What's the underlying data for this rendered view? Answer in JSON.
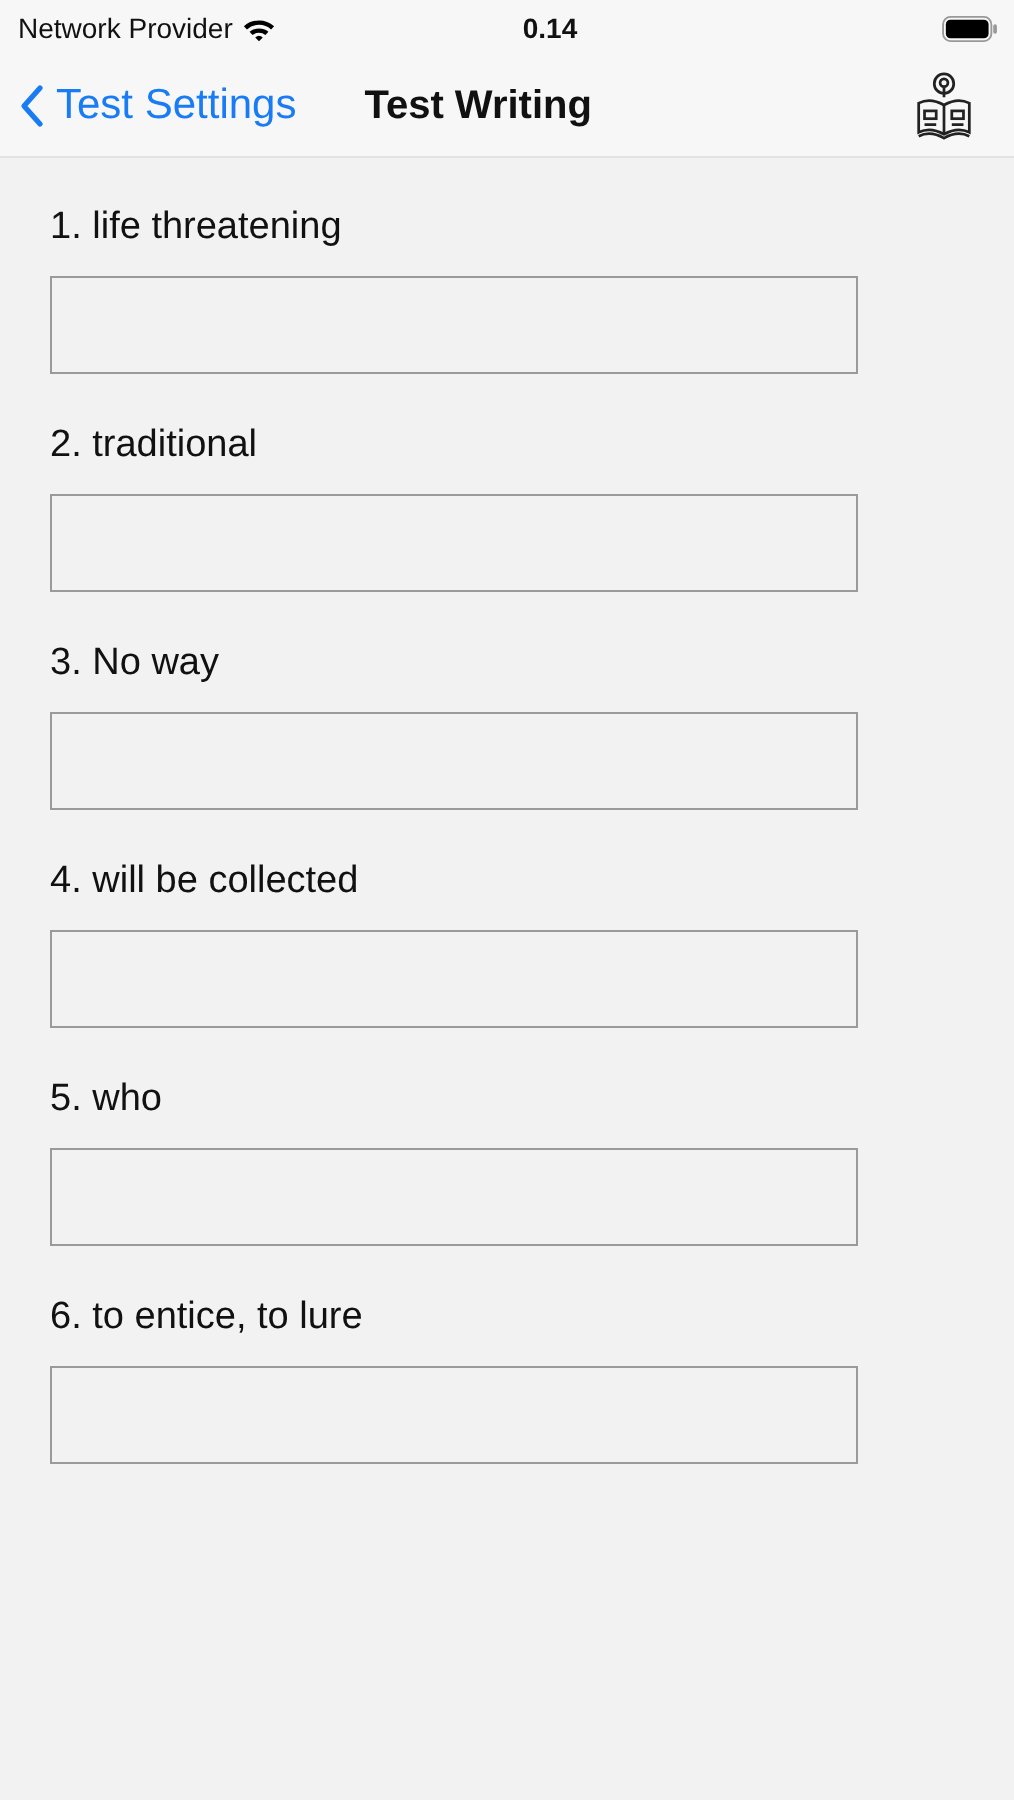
{
  "status_bar": {
    "carrier": "Network Provider",
    "time": "0.14"
  },
  "nav": {
    "back": "Test Settings",
    "title": "Test Writing"
  },
  "questions": [
    {
      "label": "1. life threatening"
    },
    {
      "label": "2. traditional"
    },
    {
      "label": "3. No way"
    },
    {
      "label": "4. will be collected"
    },
    {
      "label": "5. who"
    },
    {
      "label": "6. to entice, to lure"
    }
  ]
}
